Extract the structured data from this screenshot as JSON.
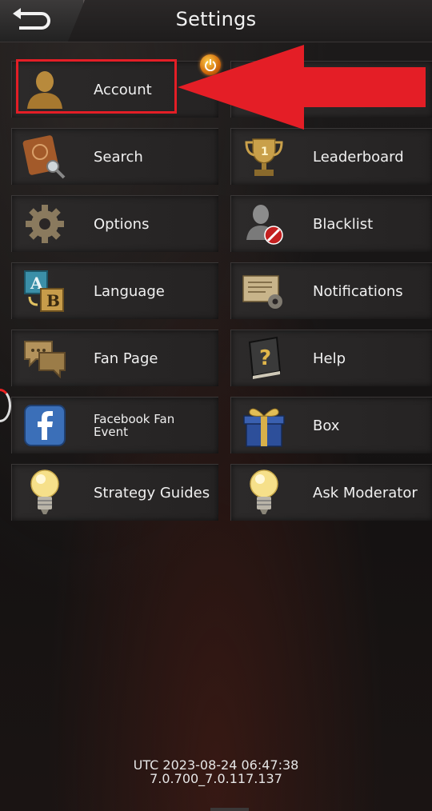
{
  "header": {
    "title": "Settings",
    "back_icon": "back-arrow-icon"
  },
  "menu": {
    "left": [
      {
        "label": "Account",
        "icon": "account-silhouette-icon"
      },
      {
        "label": "Search",
        "icon": "search-book-icon"
      },
      {
        "label": "Options",
        "icon": "gear-icon"
      },
      {
        "label": "Language",
        "icon": "language-ab-icon"
      },
      {
        "label": "Fan Page",
        "icon": "chat-bubbles-icon"
      },
      {
        "label": "Facebook Fan Event",
        "icon": "facebook-icon"
      },
      {
        "label": "Strategy Guides",
        "icon": "lightbulb-icon"
      }
    ],
    "right": [
      {
        "label": "Leaderboard",
        "icon": "trophy-icon"
      },
      {
        "label": "Blacklist",
        "icon": "blocked-user-icon"
      },
      {
        "label": "Notifications",
        "icon": "notification-letter-icon"
      },
      {
        "label": "Help",
        "icon": "help-book-icon"
      },
      {
        "label": "Box",
        "icon": "gift-box-icon"
      },
      {
        "label": "Ask Moderator",
        "icon": "lightbulb-icon"
      }
    ]
  },
  "annotation": {
    "color": "#e41e26"
  },
  "footer": {
    "utc_line": "UTC  2023-08-24 06:47:38",
    "version": "7.0.700_7.0.117.137"
  }
}
